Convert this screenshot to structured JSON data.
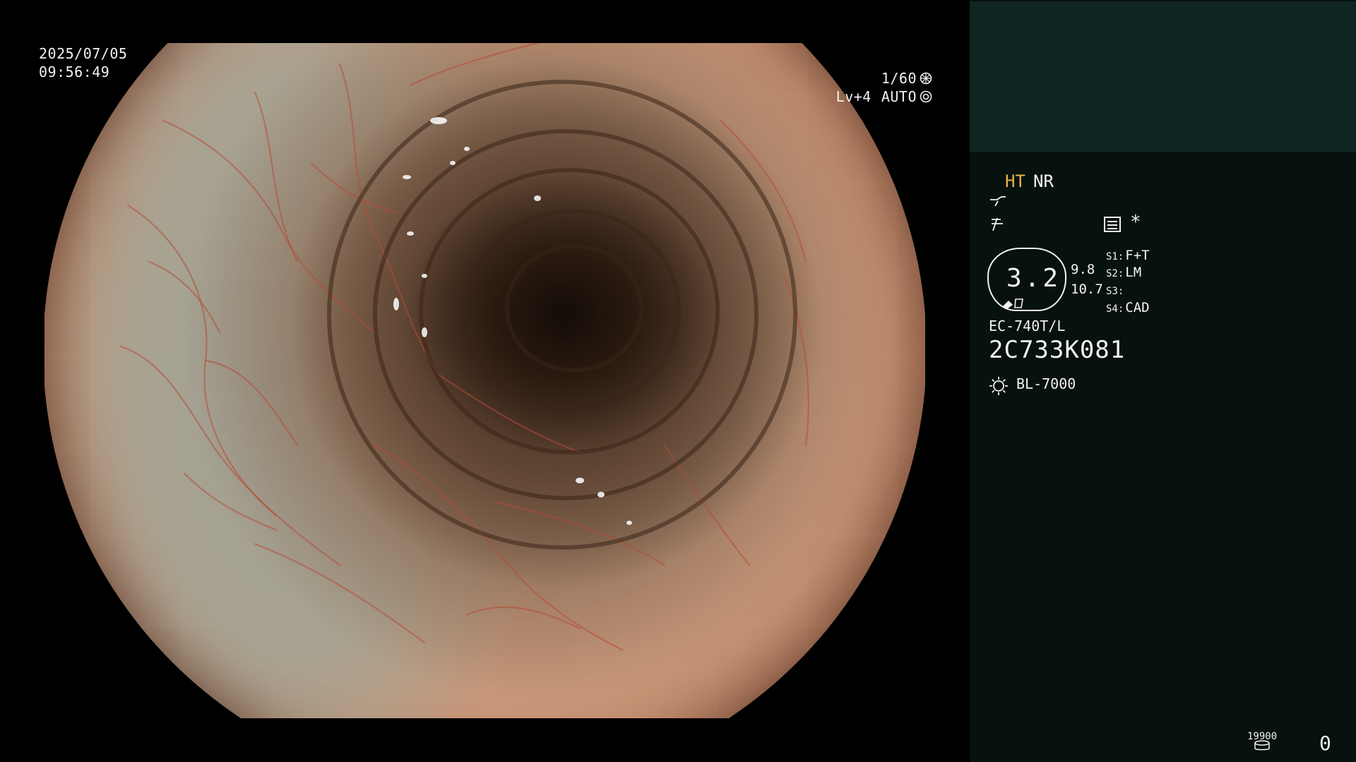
{
  "overlay": {
    "date": "2025/07/05",
    "time": "09:56:49",
    "shutter": "1/60",
    "shutter_icon": "aperture-icon",
    "level": "Lv+4",
    "iris_mode": "AUTO",
    "iris_icon": "iris-icon"
  },
  "image": {
    "description_icon": "endoscopic-view"
  },
  "panel": {
    "mode_ht": "HT",
    "mode_nr": "NR",
    "tone_icon": "tone-curve-icon",
    "enhance_icon": "enhancement-icon",
    "record_icon": "record-list-icon",
    "asterisk": "*",
    "zoom_value": "3.2",
    "value_1": "9.8",
    "value_2": "10.7",
    "switches": [
      {
        "key": "S1:",
        "value": "F+T"
      },
      {
        "key": "S2:",
        "value": "LM"
      },
      {
        "key": "S3:",
        "value": ""
      },
      {
        "key": "S4:",
        "value": "CAD"
      }
    ],
    "scope_model": "EC-740T/L",
    "scope_serial": "2C733K081",
    "light_icon": "light-source-icon",
    "light_source": "BL-7000",
    "counter_small": "19900",
    "counter_big": "0",
    "colors": {
      "panel_bg": "#07110f",
      "thumb_bg": "#0f2623",
      "highlight": "#e8b24a"
    }
  }
}
